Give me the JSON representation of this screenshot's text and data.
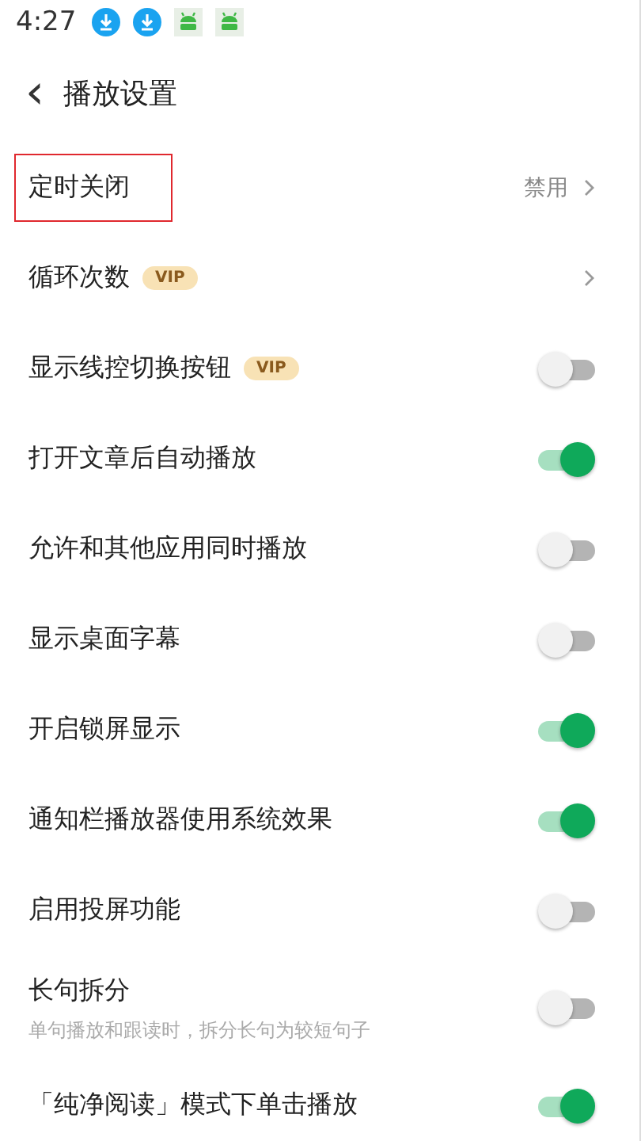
{
  "status_bar": {
    "time": "4:27",
    "icons": [
      {
        "kind": "download"
      },
      {
        "kind": "download"
      },
      {
        "kind": "robot"
      },
      {
        "kind": "robot"
      }
    ]
  },
  "header": {
    "back": "‹",
    "title": "播放设置"
  },
  "settings": [
    {
      "kind": "link",
      "label": "定时关闭",
      "value": "禁用",
      "highlighted": true
    },
    {
      "kind": "link",
      "label": "循环次数",
      "badge": "VIP"
    },
    {
      "kind": "toggle",
      "label": "显示线控切换按钮",
      "badge": "VIP",
      "on": false
    },
    {
      "kind": "toggle",
      "label": "打开文章后自动播放",
      "on": true
    },
    {
      "kind": "toggle",
      "label": "允许和其他应用同时播放",
      "on": false
    },
    {
      "kind": "toggle",
      "label": "显示桌面字幕",
      "on": false
    },
    {
      "kind": "toggle",
      "label": "开启锁屏显示",
      "on": true
    },
    {
      "kind": "toggle",
      "label": "通知栏播放器使用系统效果",
      "on": true
    },
    {
      "kind": "toggle",
      "label": "启用投屏功能",
      "on": false
    },
    {
      "kind": "toggle",
      "label": "长句拆分",
      "subtitle": "单句播放和跟读时，拆分长句为较短句子",
      "on": false
    },
    {
      "kind": "toggle",
      "label": "「纯净阅读」模式下单击播放",
      "on": true
    }
  ]
}
